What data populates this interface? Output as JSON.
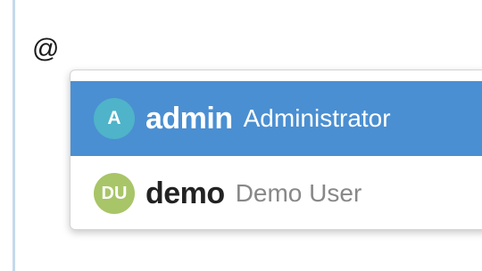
{
  "editor": {
    "text": "@"
  },
  "mentions": [
    {
      "initials": "A",
      "username": "admin",
      "fullname": "Administrator",
      "avatar_color": "#4fb3c9",
      "selected": true
    },
    {
      "initials": "DU",
      "username": "demo",
      "fullname": "Demo User",
      "avatar_color": "#a8c568",
      "selected": false
    }
  ],
  "colors": {
    "selected_bg": "#4a8fd2",
    "editor_border": "#c6d9ec",
    "secondary_text": "#888888"
  }
}
